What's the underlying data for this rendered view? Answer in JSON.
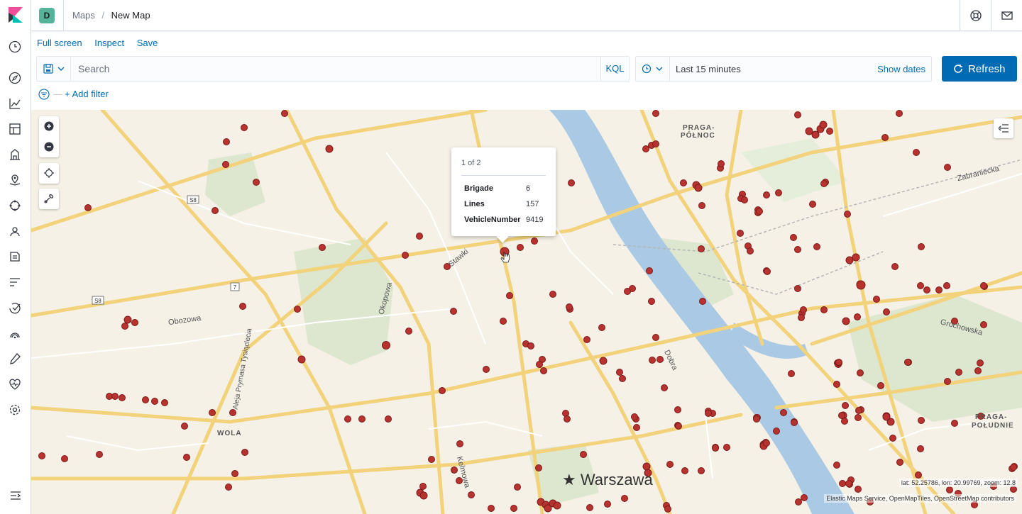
{
  "nav": {
    "items": [
      "clock-icon",
      "compass-icon",
      "visualize-icon",
      "dashboard-icon",
      "canvas-icon",
      "maps-icon",
      "ml-icon",
      "infra-icon",
      "logs-icon",
      "apm-icon",
      "uptime-icon",
      "siem-icon",
      "devtools-icon",
      "monitoring-icon",
      "management-icon"
    ]
  },
  "header": {
    "space_initial": "D",
    "breadcrumb_parent": "Maps",
    "breadcrumb_divider": "/",
    "breadcrumb_current": "New Map"
  },
  "topmenu": {
    "fullscreen": "Full screen",
    "inspect": "Inspect",
    "save": "Save"
  },
  "query": {
    "placeholder": "Search",
    "language": "KQL"
  },
  "time": {
    "range": "Last 15 minutes",
    "show_dates": "Show dates"
  },
  "refresh_label": "Refresh",
  "filter": {
    "add_label": "+ Add filter"
  },
  "tooltip": {
    "pager": "1 of 2",
    "rows": [
      {
        "key": "Brigade",
        "value": "6"
      },
      {
        "key": "Lines",
        "value": "157"
      },
      {
        "key": "VehicleNumber",
        "value": "9419"
      }
    ]
  },
  "map": {
    "city": "Warszawa",
    "districts": [
      "PRAGA-",
      "PÓŁNOC",
      "WOLA",
      "PRAGA-",
      "POŁUDNIE"
    ],
    "streets": [
      "Obozowa",
      "Stawki",
      "Okopowa",
      "Dobra",
      "Grochowska",
      "Zabraniecka",
      "Kelmowa",
      "Aleja Prymasa Tysiąclecia"
    ],
    "road_signs": [
      "S8",
      "S8",
      "7"
    ],
    "coords": "lat: 52.25786, lon: 20.99769, zoom: 12.8",
    "attribution": "Elastic Maps Service, OpenMapTiles, OpenStreetMap contributors",
    "marker_color": "#c0392b"
  }
}
